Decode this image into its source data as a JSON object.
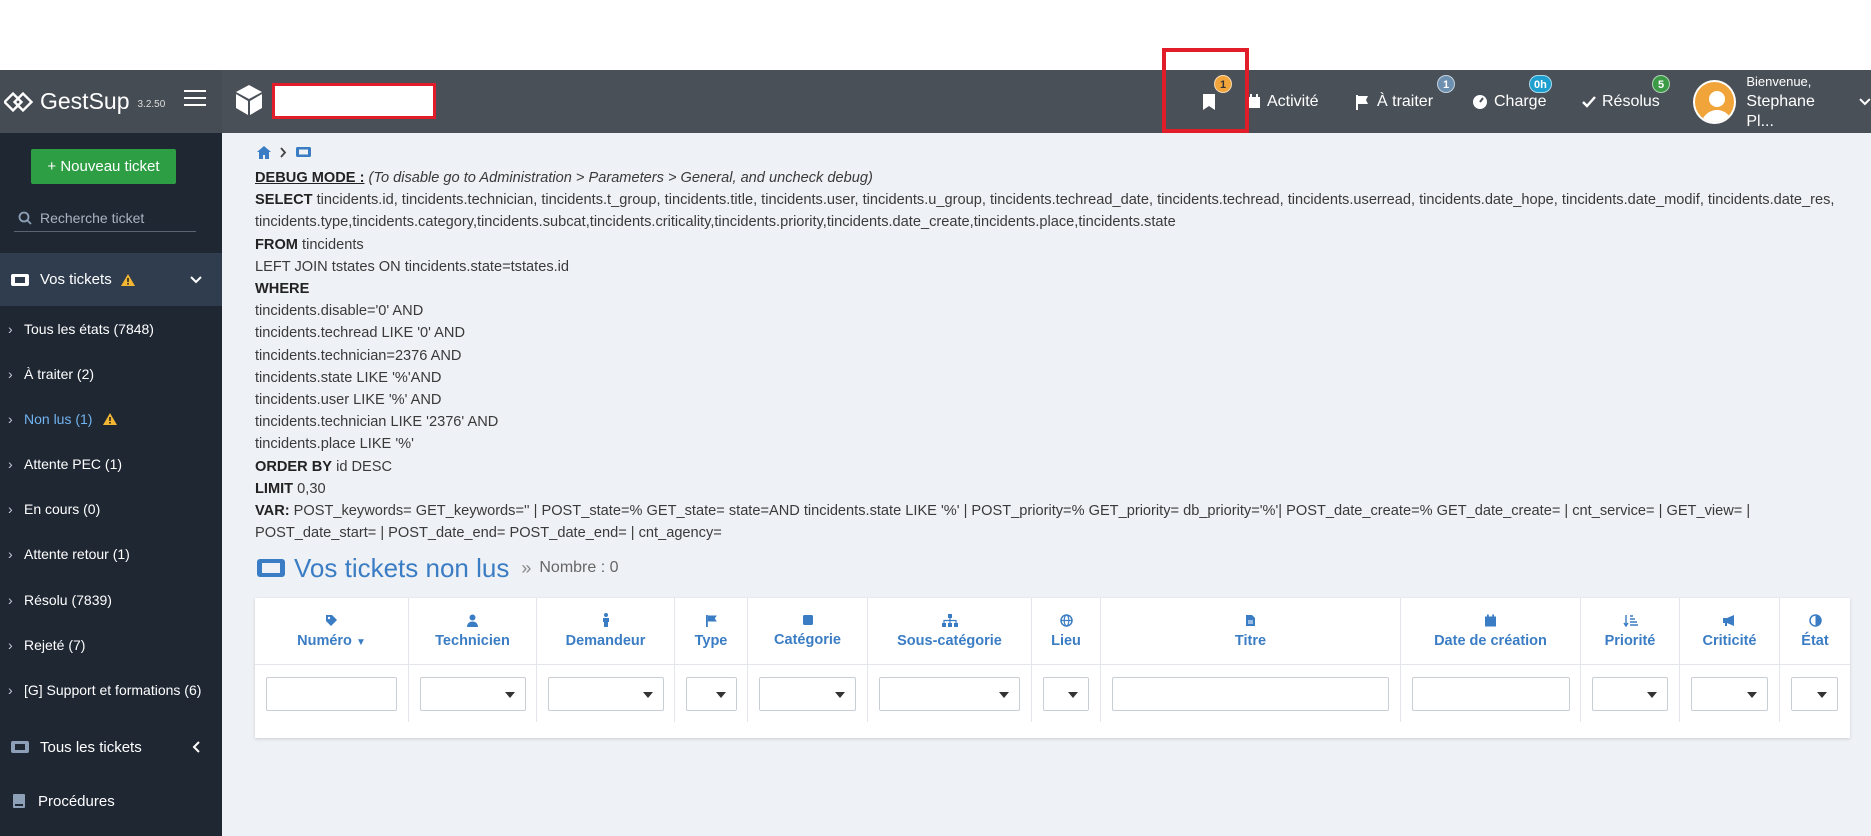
{
  "brand": {
    "name": "GestSup",
    "version": "3.2.50"
  },
  "navbar": {
    "bookmark_badge": "1",
    "activity_label": "Activité",
    "todo_label": "À traiter",
    "todo_badge": "1",
    "charge_label": "Charge",
    "charge_badge": "0h",
    "resolved_label": "Résolus",
    "resolved_badge": "5",
    "user_greeting": "Bienvenue,",
    "user_name": "Stephane Pl..."
  },
  "sidebar": {
    "new_ticket": "+ Nouveau ticket",
    "search_placeholder": "Recherche ticket",
    "your_tickets": "Vos tickets",
    "items": [
      {
        "label": "Tous les états (7848)"
      },
      {
        "label": "À traiter (2)"
      },
      {
        "label": "Non lus (1)"
      },
      {
        "label": "Attente PEC (1)"
      },
      {
        "label": "En cours (0)"
      },
      {
        "label": "Attente retour (1)"
      },
      {
        "label": "Résolu (7839)"
      },
      {
        "label": "Rejeté (7)"
      },
      {
        "label": "[G] Support et formations (6)"
      }
    ],
    "all_tickets": "Tous les tickets",
    "procedures": "Procédures"
  },
  "debug": {
    "mode_label": "DEBUG MODE :",
    "mode_note": " (To disable go to Administration > Parameters > General, and uncheck debug)",
    "select_kw": "SELECT",
    "select_text": " tincidents.id, tincidents.technician, tincidents.t_group, tincidents.title, tincidents.user, tincidents.u_group, tincidents.techread_date, tincidents.techread, tincidents.userread, tincidents.date_hope, tincidents.date_modif, tincidents.date_res, tincidents.type,tincidents.category,tincidents.subcat,tincidents.criticality,tincidents.priority,tincidents.date_create,tincidents.place,tincidents.state",
    "from_kw": "FROM",
    "from_text": " tincidents",
    "join_text": "LEFT JOIN tstates ON tincidents.state=tstates.id",
    "where_kw": "WHERE",
    "where_lines": [
      "tincidents.disable='0' AND",
      "tincidents.techread LIKE '0' AND",
      "tincidents.technician=2376 AND",
      "tincidents.state LIKE '%'AND",
      "tincidents.user LIKE '%' AND",
      "tincidents.technician LIKE '2376' AND",
      "tincidents.place LIKE '%'"
    ],
    "order_kw": "ORDER BY",
    "order_text": " id DESC",
    "limit_kw": "LIMIT",
    "limit_text": " 0,30",
    "var_kw": "VAR:",
    "var_text": " POST_keywords= GET_keywords='' | POST_state=% GET_state= state=AND tincidents.state LIKE '%' | POST_priority=% GET_priority= db_priority='%'| POST_date_create=% GET_date_create= | cnt_service= | GET_view= | POST_date_start= | POST_date_end= POST_date_end= | cnt_agency="
  },
  "page": {
    "title": "Vos tickets non lus",
    "count": "Nombre : 0"
  },
  "table": {
    "columns": [
      "Numéro",
      "Technicien",
      "Demandeur",
      "Type",
      "Catégorie",
      "Sous-catégorie",
      "Lieu",
      "Titre",
      "Date de création",
      "Priorité",
      "Criticité",
      "État"
    ]
  },
  "colors": {
    "navbar": "#4a5058",
    "sidebar": "#1f2733",
    "accent": "#3b7dc4",
    "green": "#2e9e44",
    "highlight": "#e11d2a"
  }
}
